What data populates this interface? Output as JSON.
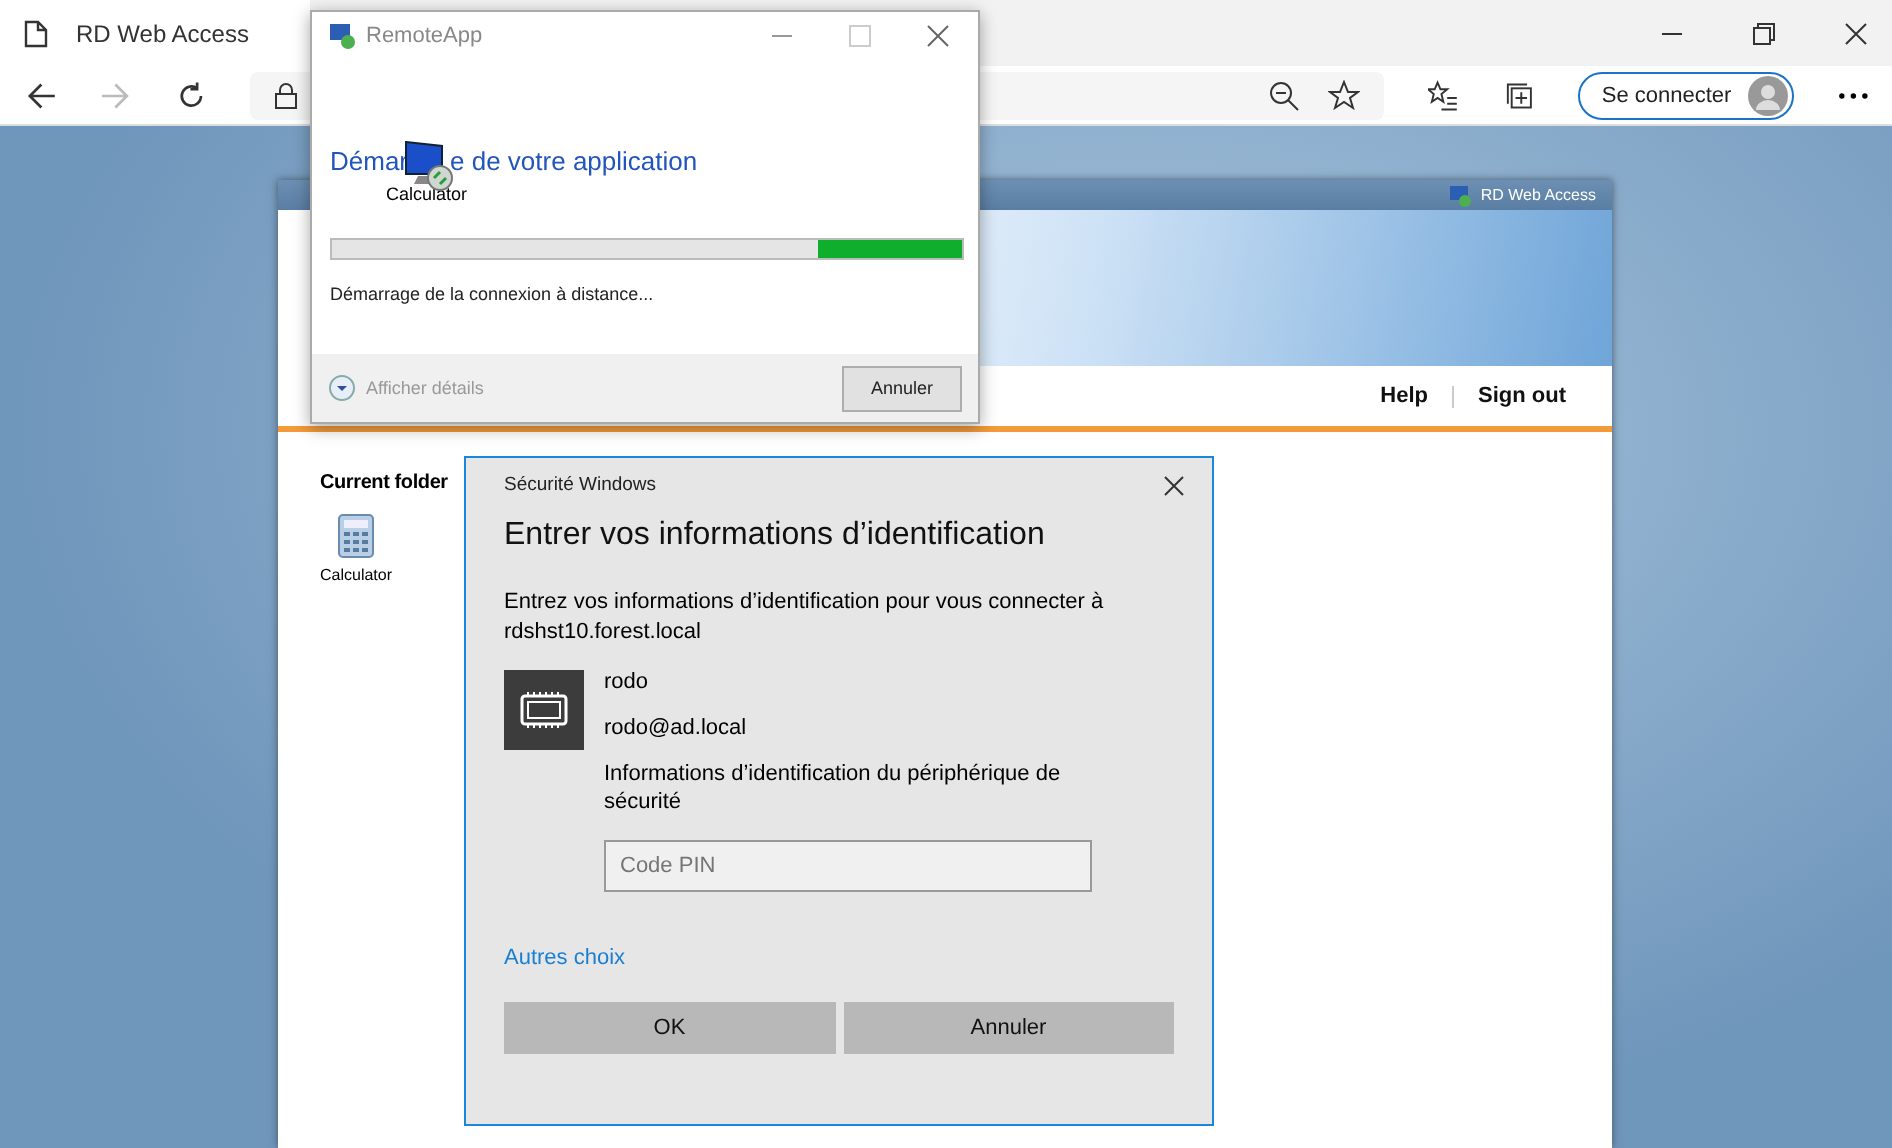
{
  "browser": {
    "tab": {
      "title": "RD Web Access",
      "selected": true
    },
    "sign_in_button": "Se connecter"
  },
  "rd_web": {
    "header_title": "RD Web Access",
    "nav": [
      "Help",
      "Sign out"
    ],
    "current_folder": "Current folder",
    "apps": [
      {
        "label": "Calculator"
      }
    ]
  },
  "remoteapp_window": {
    "title": "RemoteApp",
    "heading_parts": [
      "Démar",
      "e de votre application"
    ],
    "app_name": "Calculator",
    "progress": {
      "level": 0.23
    },
    "status": "Démarrage de la connexion à distance...",
    "details_toggle": "Afficher détails",
    "cancel_button": "Annuler"
  },
  "security_dialog": {
    "title": "Sécurité Windows",
    "heading": "Entrer vos informations d’identification",
    "message": "Entrez vos informations d’identification pour vous connecter à rdshst10.forest.local",
    "user_name": "rodo",
    "user_principal": "rodo@ad.local",
    "credential_label": "Informations d’identification du périphérique de sécurité",
    "pin_field": {
      "placeholder": "Code PIN"
    },
    "other_choices_link": "Autres choix",
    "buttons": [
      "OK",
      "Annuler"
    ]
  }
}
